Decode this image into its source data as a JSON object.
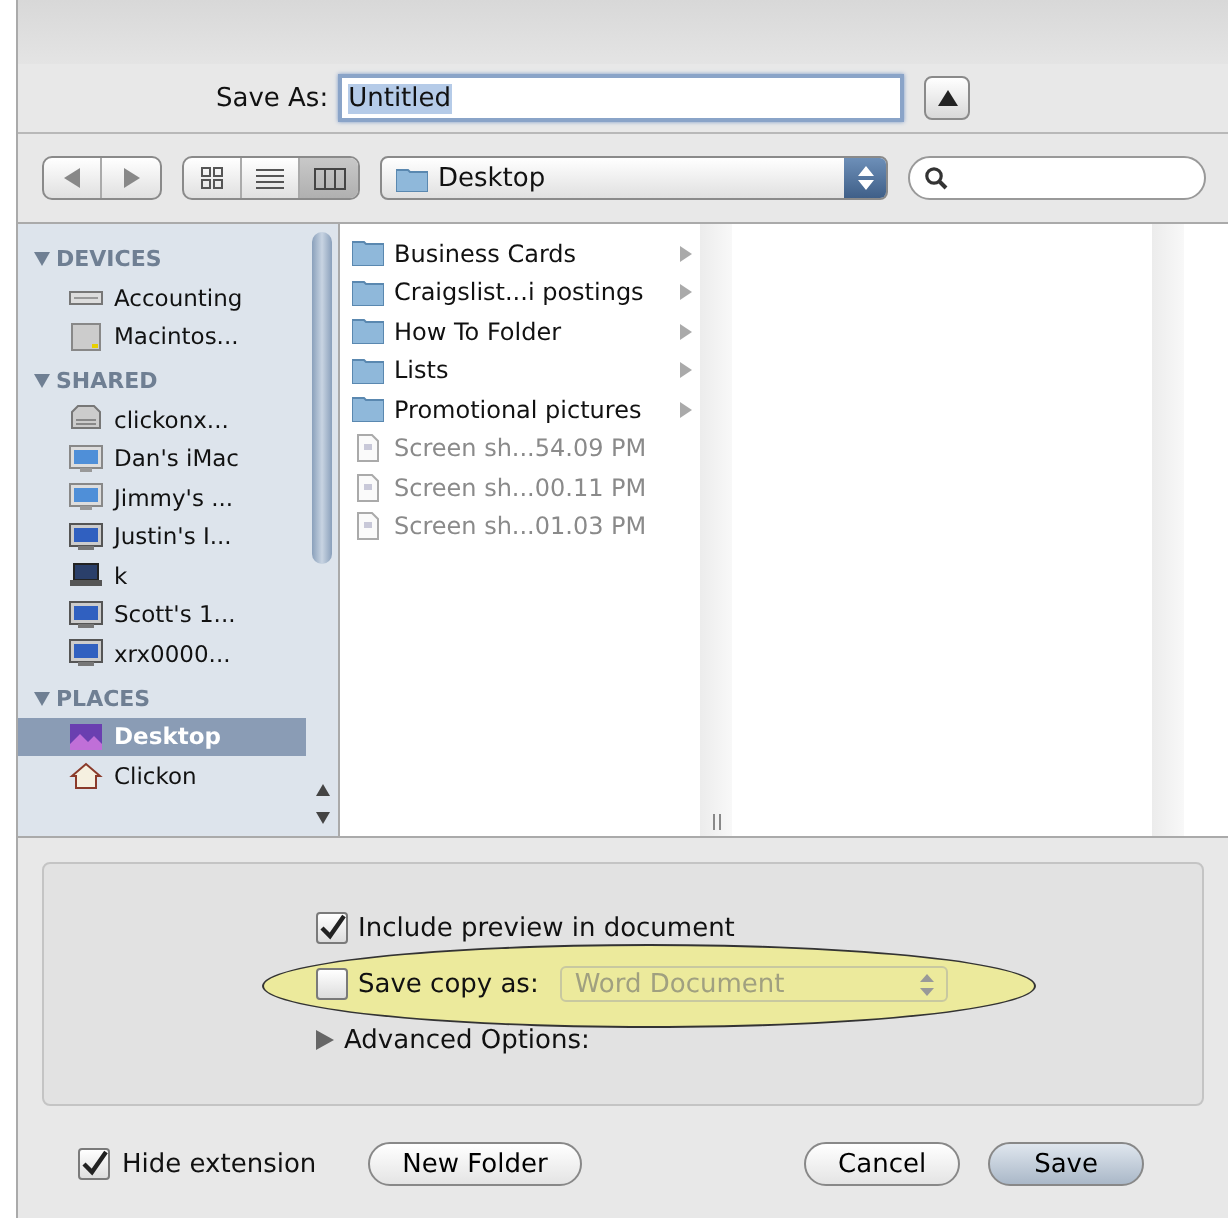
{
  "save_as": {
    "label": "Save As:",
    "value": "Untitled"
  },
  "toolbar": {
    "views": [
      {
        "kind": "icons",
        "selected": false
      },
      {
        "kind": "list",
        "selected": false
      },
      {
        "kind": "columns",
        "selected": true
      }
    ],
    "location": "Desktop"
  },
  "sidebar": [
    {
      "heading": "DEVICES",
      "expanded": true,
      "items": [
        {
          "label": "Accounting",
          "kind": "drive",
          "selected": false
        },
        {
          "label": "Macintos...",
          "kind": "disk",
          "selected": false
        }
      ]
    },
    {
      "heading": "SHARED",
      "expanded": true,
      "items": [
        {
          "label": "clickonx...",
          "kind": "server",
          "selected": false
        },
        {
          "label": "Dan's iMac",
          "kind": "imac",
          "selected": false
        },
        {
          "label": "Jimmy's ...",
          "kind": "imac",
          "selected": false
        },
        {
          "label": "Justin's I...",
          "kind": "monitor",
          "selected": false
        },
        {
          "label": "k",
          "kind": "laptop",
          "selected": false
        },
        {
          "label": "Scott's 1...",
          "kind": "monitor",
          "selected": false
        },
        {
          "label": "xrx0000...",
          "kind": "monitor",
          "selected": false
        }
      ]
    },
    {
      "heading": "PLACES",
      "expanded": true,
      "items": [
        {
          "label": "Desktop",
          "kind": "desktop",
          "selected": true
        },
        {
          "label": "Clickon",
          "kind": "home",
          "selected": false
        }
      ]
    }
  ],
  "files": [
    {
      "name": "Business Cards",
      "kind": "folder",
      "disabled": false
    },
    {
      "name": "Craigslist...i postings",
      "kind": "folder",
      "disabled": false
    },
    {
      "name": "How To Folder",
      "kind": "folder",
      "disabled": false
    },
    {
      "name": "Lists",
      "kind": "folder",
      "disabled": false
    },
    {
      "name": "Promotional pictures",
      "kind": "folder",
      "disabled": false
    },
    {
      "name": "Screen sh...54.09 PM",
      "kind": "document",
      "disabled": true
    },
    {
      "name": "Screen sh...00.11 PM",
      "kind": "document",
      "disabled": true
    },
    {
      "name": "Screen sh...01.03 PM",
      "kind": "document",
      "disabled": true
    }
  ],
  "options": [
    {
      "kind": "checkbox",
      "label": "Include preview in document",
      "checked": true,
      "highlighted": false
    },
    {
      "kind": "checkbox-select",
      "label": "Save copy as:",
      "checked": false,
      "value": "Word Document",
      "disabled": true,
      "highlighted": true
    },
    {
      "kind": "disclosure",
      "label": "Advanced Options:",
      "expanded": false,
      "highlighted": false
    }
  ],
  "hide_extension": {
    "label": "Hide extension",
    "checked": true
  },
  "buttons": [
    {
      "label": "New Folder",
      "kind": "normal"
    },
    {
      "label": "Cancel",
      "kind": "normal"
    },
    {
      "label": "Save",
      "kind": "default"
    }
  ]
}
